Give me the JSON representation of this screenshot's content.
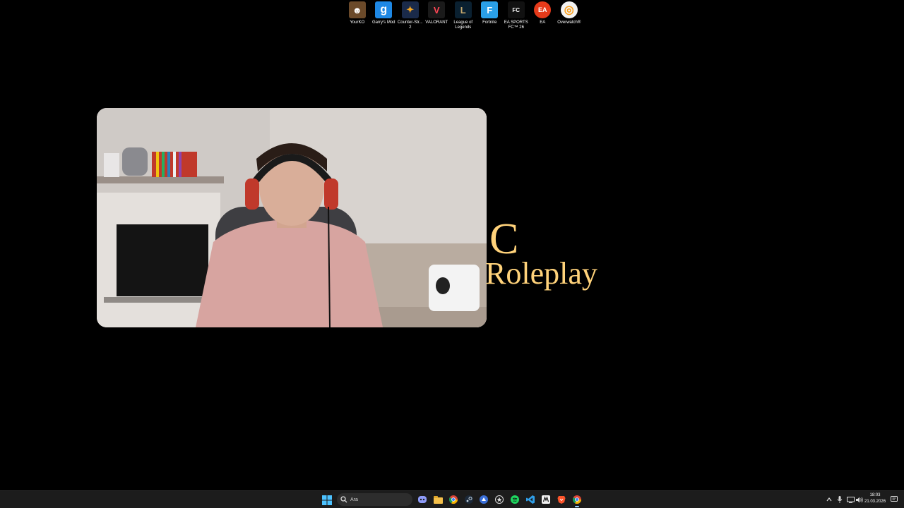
{
  "desktop_icons": [
    {
      "label": "YourKO",
      "color": "#6b4a2a",
      "icon": "game-character-icon"
    },
    {
      "label": "Garry's Mod",
      "color": "#1e88e5",
      "icon": "gmod-icon"
    },
    {
      "label": "Counter-Str... 2",
      "color": "#1a2a4a",
      "icon": "cs2-icon"
    },
    {
      "label": "VALORANT",
      "color": "#1a1a1a",
      "icon": "valorant-icon"
    },
    {
      "label": "League of Legends",
      "color": "#0a2030",
      "icon": "league-icon"
    },
    {
      "label": "Fortnite",
      "color": "#2aa0e8",
      "icon": "fortnite-icon"
    },
    {
      "label": "EA SPORTS FC™ 26",
      "color": "#111111",
      "icon": "eafc-icon"
    },
    {
      "label": "EA",
      "color": "#e63a1a",
      "icon": "ea-icon"
    },
    {
      "label": "Overwatch®",
      "color": "#f2f2f2",
      "icon": "overwatch-icon"
    }
  ],
  "overlay": {
    "letter": "C",
    "word": "Roleplay",
    "color": "#ffd27a"
  },
  "taskbar": {
    "search_placeholder": "Ara",
    "apps": [
      "discord-icon",
      "file-explorer-icon",
      "chrome-icon",
      "steam-icon",
      "riot-client-icon",
      "rockstar-icon",
      "spotify-icon",
      "vscode-icon",
      "capcut-icon",
      "brave-icon",
      "chrome-profile-icon"
    ],
    "time": "18:03",
    "date": "21.03.2026"
  }
}
